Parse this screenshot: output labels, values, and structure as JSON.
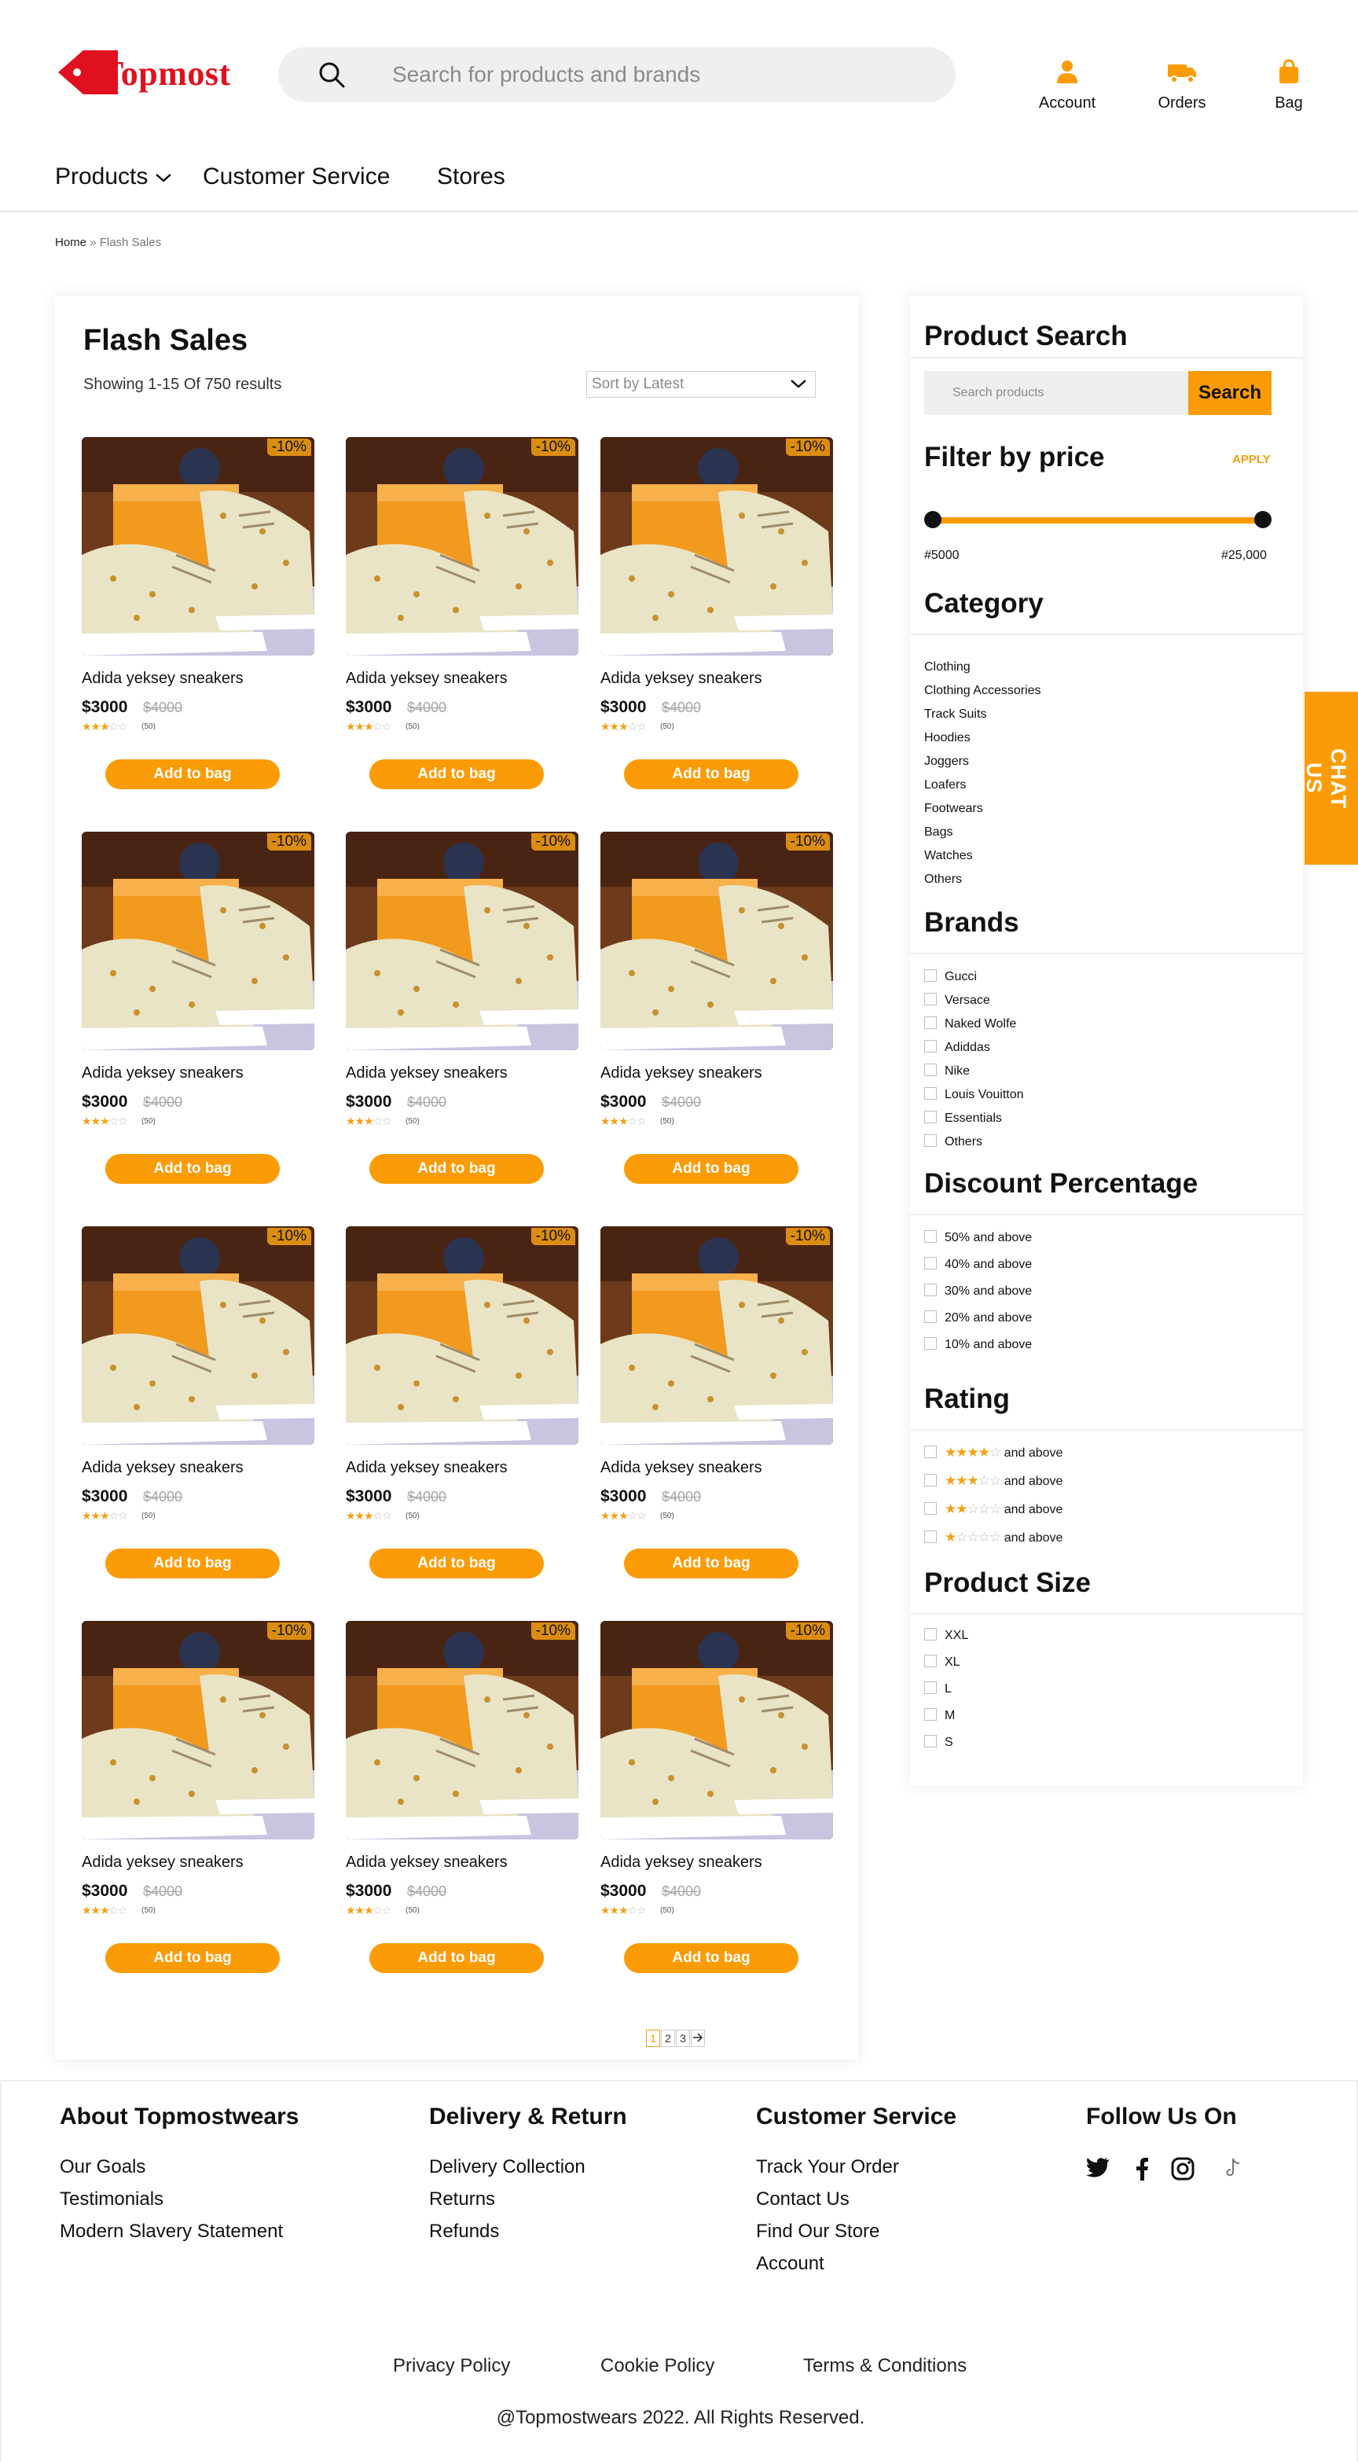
{
  "brand": {
    "name": "Topmost",
    "color": "#e0101e",
    "accent": "#fb9b05"
  },
  "header": {
    "search_placeholder": "Search for products and brands",
    "actions": [
      {
        "label": "Account",
        "icon": "user-icon"
      },
      {
        "label": "Orders",
        "icon": "truck-icon"
      },
      {
        "label": "Bag",
        "icon": "bag-icon"
      }
    ],
    "nav": [
      "Products",
      "Customer Service",
      "Stores"
    ]
  },
  "breadcrumb": {
    "home": "Home",
    "sep": "»",
    "current": "Flash Sales"
  },
  "main": {
    "title": "Flash Sales",
    "results": "Showing 1-15 Of 750 results",
    "sort_label": "Sort by Latest",
    "products": [
      {
        "name": "Adida yeksey sneakers",
        "price": "$3000",
        "old_price": "$4000",
        "rating": 3,
        "reviews": "(50)",
        "discount": "-10%",
        "cta": "Add to bag"
      },
      {
        "name": "Adida yeksey sneakers",
        "price": "$3000",
        "old_price": "$4000",
        "rating": 3,
        "reviews": "(50)",
        "discount": "-10%",
        "cta": "Add to bag"
      },
      {
        "name": "Adida yeksey sneakers",
        "price": "$3000",
        "old_price": "$4000",
        "rating": 3,
        "reviews": "(50)",
        "discount": "-10%",
        "cta": "Add to bag"
      },
      {
        "name": "Adida yeksey sneakers",
        "price": "$3000",
        "old_price": "$4000",
        "rating": 3,
        "reviews": "(50)",
        "discount": "-10%",
        "cta": "Add to bag"
      },
      {
        "name": "Adida yeksey sneakers",
        "price": "$3000",
        "old_price": "$4000",
        "rating": 3,
        "reviews": "(50)",
        "discount": "-10%",
        "cta": "Add to bag"
      },
      {
        "name": "Adida yeksey sneakers",
        "price": "$3000",
        "old_price": "$4000",
        "rating": 3,
        "reviews": "(50)",
        "discount": "-10%",
        "cta": "Add to bag"
      },
      {
        "name": "Adida yeksey sneakers",
        "price": "$3000",
        "old_price": "$4000",
        "rating": 3,
        "reviews": "(50)",
        "discount": "-10%",
        "cta": "Add to bag"
      },
      {
        "name": "Adida yeksey sneakers",
        "price": "$3000",
        "old_price": "$4000",
        "rating": 3,
        "reviews": "(50)",
        "discount": "-10%",
        "cta": "Add to bag"
      },
      {
        "name": "Adida yeksey sneakers",
        "price": "$3000",
        "old_price": "$4000",
        "rating": 3,
        "reviews": "(50)",
        "discount": "-10%",
        "cta": "Add to bag"
      },
      {
        "name": "Adida yeksey sneakers",
        "price": "$3000",
        "old_price": "$4000",
        "rating": 3,
        "reviews": "(50)",
        "discount": "-10%",
        "cta": "Add to bag"
      },
      {
        "name": "Adida yeksey sneakers",
        "price": "$3000",
        "old_price": "$4000",
        "rating": 3,
        "reviews": "(50)",
        "discount": "-10%",
        "cta": "Add to bag"
      },
      {
        "name": "Adida yeksey sneakers",
        "price": "$3000",
        "old_price": "$4000",
        "rating": 3,
        "reviews": "(50)",
        "discount": "-10%",
        "cta": "Add to bag"
      }
    ],
    "pagination": [
      "1",
      "2",
      "3"
    ],
    "pagination_active": "1"
  },
  "sidebar": {
    "search_title": "Product Search",
    "search_placeholder": "Search products",
    "search_button": "Search",
    "price_title": "Filter by price",
    "apply_label": "APPLY",
    "price_min": "#5000",
    "price_max": "#25,000",
    "category_title": "Category",
    "categories": [
      "Clothing",
      "Clothing Accessories",
      "Track Suits",
      "Hoodies",
      "Joggers",
      "Loafers",
      "Footwears",
      "Bags",
      "Watches",
      "Others"
    ],
    "brands_title": "Brands",
    "brands": [
      "Gucci",
      "Versace",
      "Naked Wolfe",
      "Adiddas",
      "Nike",
      "Louis Vouitton",
      "Essentials",
      "Others"
    ],
    "discount_title": "Discount Percentage",
    "discounts": [
      "50% and above",
      "40% and above",
      "30% and above",
      "20% and above",
      "10% and above"
    ],
    "rating_title": "Rating",
    "ratings": [
      {
        "stars": 4,
        "label": "and above"
      },
      {
        "stars": 3,
        "label": "and above"
      },
      {
        "stars": 2,
        "label": "and above"
      },
      {
        "stars": 1,
        "label": "and above"
      }
    ],
    "size_title": "Product Size",
    "sizes": [
      "XXL",
      "XL",
      "L",
      "M",
      "S"
    ]
  },
  "chat_label": "CHAT US",
  "footer": {
    "about_title": "About Topmostwears",
    "about_links": [
      "Our Goals",
      "Testimonials",
      "Modern Slavery Statement"
    ],
    "delivery_title": "Delivery & Return",
    "delivery_links": [
      "Delivery Collection",
      "Returns",
      "Refunds"
    ],
    "service_title": "Customer Service",
    "service_links": [
      "Track Your Order",
      "Contact Us",
      "Find Our Store",
      "Account"
    ],
    "follow_title": "Follow Us On",
    "social_icons": [
      "twitter-icon",
      "facebook-icon",
      "instagram-icon",
      "tiktok-icon"
    ],
    "legal_links": [
      "Privacy Policy",
      "Cookie Policy",
      "Terms & Conditions"
    ],
    "copyright": "@Topmostwears 2022. All Rights Reserved."
  }
}
